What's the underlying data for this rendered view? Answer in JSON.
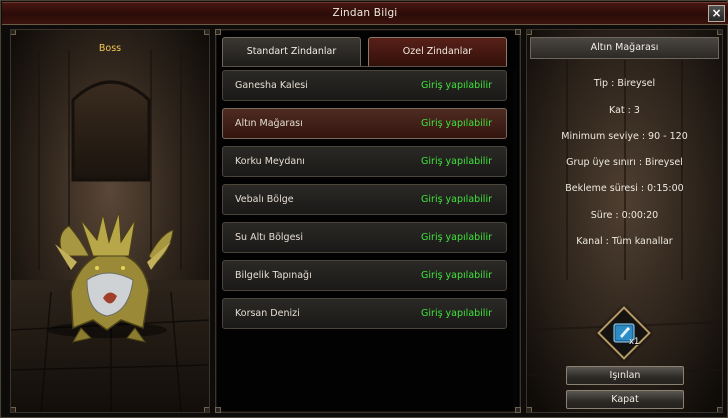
{
  "window": {
    "title": "Zindan Bilgi",
    "close_icon": "close-icon"
  },
  "boss_panel": {
    "label": "Boss"
  },
  "tabs": [
    {
      "label": "Standart Zindanlar",
      "active": false
    },
    {
      "label": "Ozel Zindanlar",
      "active": true
    }
  ],
  "dungeons": [
    {
      "name": "Ganesha Kalesi",
      "status": "Giriş yapılabilir",
      "selected": false
    },
    {
      "name": "Altın Mağarası",
      "status": "Giriş yapılabilir",
      "selected": true
    },
    {
      "name": "Korku Meydanı",
      "status": "Giriş yapılabilir",
      "selected": false
    },
    {
      "name": "Vebalı Bölge",
      "status": "Giriş yapılabilir",
      "selected": false
    },
    {
      "name": "Su Altı Bölgesi",
      "status": "Giriş yapılabilir",
      "selected": false
    },
    {
      "name": "Bilgelik Tapınağı",
      "status": "Giriş yapılabilir",
      "selected": false
    },
    {
      "name": "Korsan Denizi",
      "status": "Giriş yapılabilir",
      "selected": false
    }
  ],
  "info": {
    "title": "Altın Mağarası",
    "lines": [
      "Tip : Bireysel",
      "Kat : 3",
      "Minimum seviye : 90 - 120",
      "Grup üye sınırı : Bireysel",
      "Bekleme süresi : 0:15:00",
      "Süre : 0:00:20",
      "Kanal : Tüm kanallar"
    ],
    "required_item": {
      "icon": "blue-book-icon",
      "count": "x1"
    },
    "buttons": {
      "teleport": "Işınlan",
      "close": "Kapat"
    }
  },
  "colors": {
    "status_green": "#3ee43a",
    "boss_label": "#f2c957",
    "title_red": "#4a1712"
  }
}
